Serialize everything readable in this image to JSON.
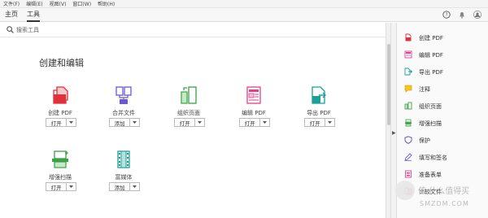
{
  "menubar": [
    "文件(F)",
    "编辑(E)",
    "视图(V)",
    "窗口(W)",
    "帮助(H)"
  ],
  "tabs": {
    "home": "主页",
    "tools": "工具"
  },
  "search": {
    "placeholder": "搜索工具"
  },
  "section_title": "创建和编辑",
  "tools": [
    {
      "name": "创建 PDF",
      "button": "打开",
      "icon": "create-pdf-icon",
      "color": "#e0303a"
    },
    {
      "name": "合并文件",
      "button": "添加",
      "icon": "combine-files-icon",
      "color": "#6a5acd"
    },
    {
      "name": "组织页面",
      "button": "打开",
      "icon": "organize-pages-icon",
      "color": "#3aa145"
    },
    {
      "name": "编辑 PDF",
      "button": "打开",
      "icon": "edit-pdf-icon",
      "color": "#e0408a"
    },
    {
      "name": "导出 PDF",
      "button": "打开",
      "icon": "export-pdf-icon",
      "color": "#1aa097"
    },
    {
      "name": "增强扫描",
      "button": "打开",
      "icon": "enhance-scan-icon",
      "color": "#3aa145"
    },
    {
      "name": "富媒体",
      "button": "添加",
      "icon": "rich-media-icon",
      "color": "#1aa097"
    }
  ],
  "sidebar": [
    {
      "label": "创建 PDF",
      "icon": "create-pdf-icon",
      "color": "#e0303a"
    },
    {
      "label": "编辑 PDF",
      "icon": "edit-pdf-icon",
      "color": "#e0408a"
    },
    {
      "label": "导出 PDF",
      "icon": "export-pdf-icon",
      "color": "#1aa097"
    },
    {
      "label": "注释",
      "icon": "comment-icon",
      "color": "#e8b400"
    },
    {
      "label": "组织页面",
      "icon": "organize-pages-icon",
      "color": "#3aa145"
    },
    {
      "label": "增强扫描",
      "icon": "enhance-scan-icon",
      "color": "#3aa145"
    },
    {
      "label": "保护",
      "icon": "protect-icon",
      "color": "#4a4ab0"
    },
    {
      "label": "填写和签名",
      "icon": "fill-sign-icon",
      "color": "#6a5acd"
    },
    {
      "label": "准备表单",
      "icon": "prepare-form-icon",
      "color": "#e0408a"
    },
    {
      "label": "比较文件",
      "icon": "compare-files-icon",
      "color": "#e0303a"
    }
  ],
  "watermark": {
    "text": "值 什么值得买",
    "domain": "SMZDM.COM"
  }
}
